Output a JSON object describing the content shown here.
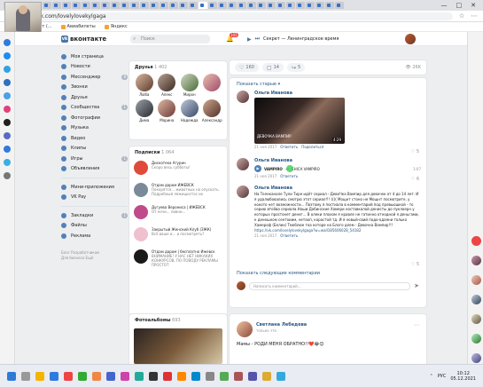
{
  "browser": {
    "url": "vk.com/lovelylovekylgaga",
    "bookmarks": [
      "...ели заходит (...",
      "Авиабилеты",
      "Яндекс"
    ],
    "window_controls": [
      "—",
      "□",
      "✕"
    ]
  },
  "vk_header": {
    "logo": "вконтакте",
    "search_placeholder": "Поиск",
    "notif_count": "105",
    "player_text": "Секрет — Ленинградское время"
  },
  "menu": {
    "items": [
      {
        "label": "Моя страница",
        "count": ""
      },
      {
        "label": "Новости",
        "count": ""
      },
      {
        "label": "Мессенджер",
        "count": "8"
      },
      {
        "label": "Звонки",
        "count": ""
      },
      {
        "label": "Друзья",
        "count": ""
      },
      {
        "label": "Сообщества",
        "count": "1"
      },
      {
        "label": "Фотографии",
        "count": ""
      },
      {
        "label": "Музыка",
        "count": ""
      },
      {
        "label": "Видео",
        "count": ""
      },
      {
        "label": "Клипы",
        "count": ""
      },
      {
        "label": "Игры",
        "count": "1"
      },
      {
        "label": "Объявления",
        "count": ""
      }
    ],
    "items2": [
      {
        "label": "Мини-приложения",
        "count": ""
      },
      {
        "label": "VK Pay",
        "count": ""
      }
    ],
    "items3": [
      {
        "label": "Закладки",
        "count": "1"
      },
      {
        "label": "Файлы",
        "count": ""
      },
      {
        "label": "Реклама",
        "count": ""
      }
    ],
    "footer": "Блог  Разработчикам\nДля бизнеса  Ещё"
  },
  "friends": {
    "title": "Друзья",
    "count": "1 402",
    "list": [
      "Люба",
      "Алекс",
      "Мирон",
      "",
      "Дима",
      "Марина",
      "Надежда",
      "Александр"
    ]
  },
  "subscriptions": {
    "title": "Подписки",
    "count": "1 064",
    "list": [
      {
        "name": "Дискотека Агурин",
        "desc": "Скоро весь субботы!"
      },
      {
        "name": "Отдам даром ИЖЕВСК",
        "desc": "Покорятся... животных на опускать. Подробный ляжищестос их"
      },
      {
        "name": "Дугуева Верониса | ИЖЕВСК",
        "desc": "От ночи... ливни..."
      },
      {
        "name": "Закрытый Женский Клуб (ЗЖК)",
        "desc": "Всё ваше и... и посмотреть?"
      },
      {
        "name": "Отдам даром | бесплатно Ижевск",
        "desc": "ВНИМАНИЕ! У НАС НЕТ НИКАКИХ КОНКУРСОВ, ПО ПОВОДУ РЕКЛАМЫ ПРОСТОТ"
      }
    ]
  },
  "photos": {
    "title": "Фотоальбомы",
    "count": "693"
  },
  "feed_actions": {
    "likes": "160",
    "comments": "14",
    "shares": "5",
    "views": "26K"
  },
  "comments": {
    "show_prev": "Показать старые ▾",
    "c1": {
      "author": "Ольга Иванова",
      "video_title": "ДЕВОЧКА ВАМПИР",
      "video_duration": "4:29",
      "date": "21 ноя 2017",
      "reply": "Ответить",
      "share": "Поделиться",
      "likes": "5"
    },
    "c2": {
      "author": "Ольга Иванова",
      "artist": "VAMPIRO",
      "track": "CHICA VAMPIRO",
      "duration": "3:07",
      "date": "21 ноя 2017",
      "reply": "Ответить",
      "likes": "6"
    },
    "c3": {
      "author": "Ольга Иванова",
      "text": "На Телеканале Тули Тире идёт сериал - ДевоЧка Вампир для девочек от 4 до 14 лет. И я удалюбовались смотрю этот сериал!!! (((( Мощнт стоно не Мощнт посмотрите, у кокото нет возможности... Поэтому я постиала в комментарий под превьюшкой - то серию втоёва сериала.Наши Добинские Хамери ноставкалой денисты до пуклоерн у которых простонет денег... В олеки плохом я нравле не гатинно отнодной я деньгами, к денешном сентоиим, нетаоп, корастой тд. И я новый-свий подо-одаяни только Хамероф (Белих) Тмоблюе тоа которе на Блого длем - Девочка Вампир!!!",
      "link": "https://vk.com/lovelylovekylgaga?w=wall185606028_54182",
      "date": "21 ноя 2017",
      "reply": "Ответить",
      "likes": "5"
    },
    "show_next": "Показать следующие комментарии",
    "write_placeholder": "Написать комментарий..."
  },
  "post2": {
    "author": "Светлана Лебедева",
    "time": "только что",
    "text": "Мамы - РОДИ МЕНЯ ОБРАТНО!!❤️😂😊"
  },
  "taskbar": {
    "lang": "РУС",
    "time": "10:12",
    "date": "05.12.2021"
  },
  "colors": {
    "vk_blue": "#4a76a8",
    "link": "#2a5885",
    "page_bg": "#edeef0"
  }
}
